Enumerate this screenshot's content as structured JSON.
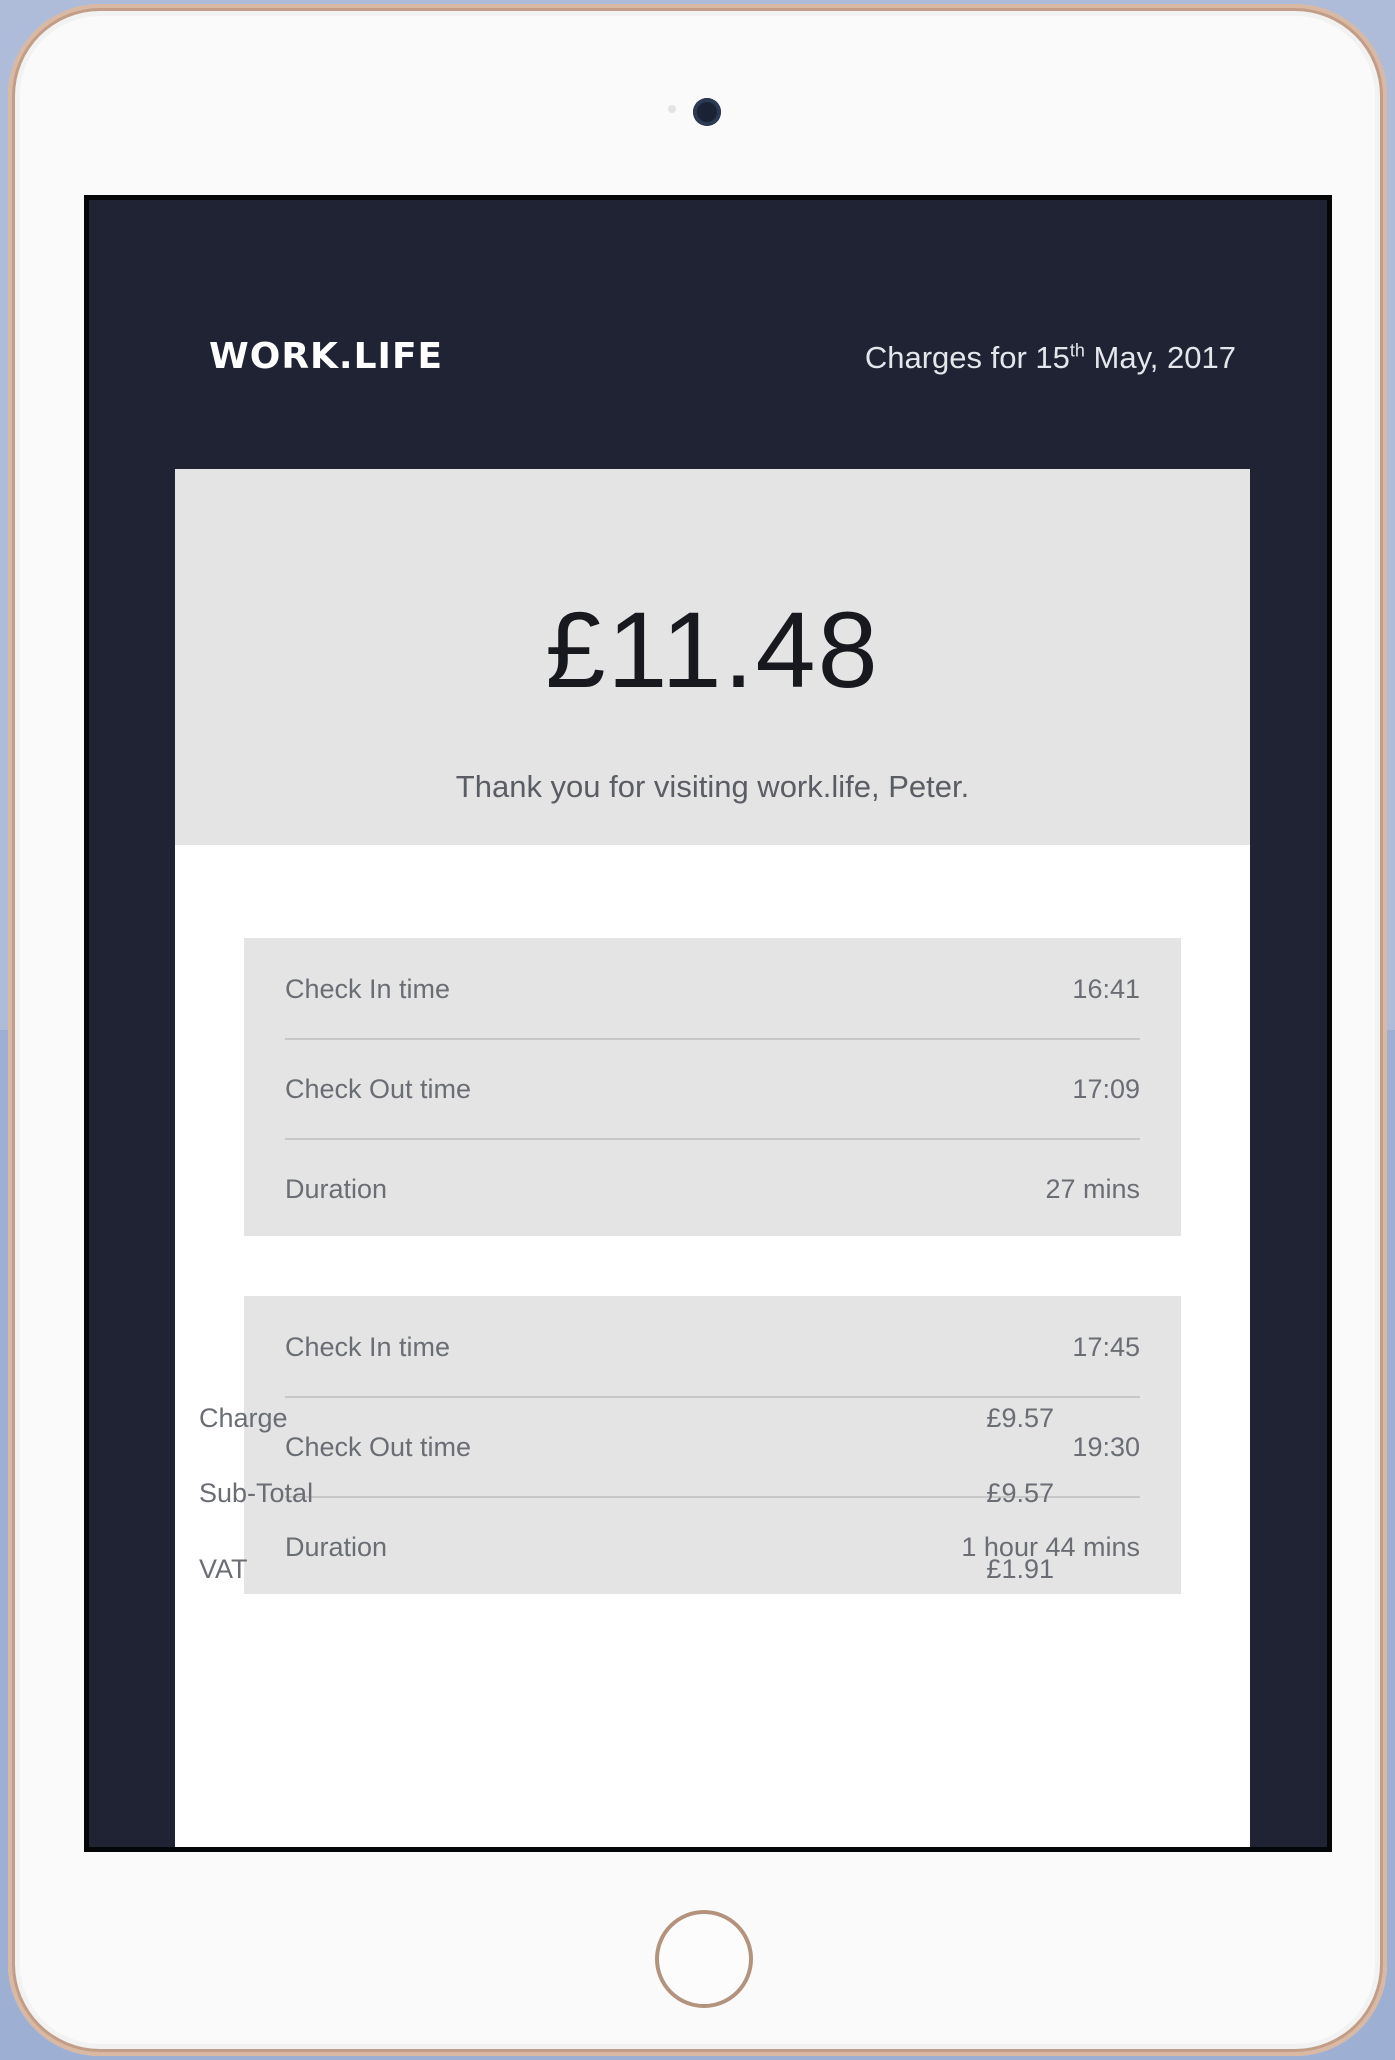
{
  "header": {
    "logo_text": "WORK.LIFE",
    "charges_prefix": "Charges for 15",
    "charges_suffix_sup": "th",
    "charges_rest": " May, 2017"
  },
  "summary": {
    "total_amount": "£11.48",
    "thank_you": "Thank you for visiting work.life, Peter."
  },
  "sessions": [
    {
      "check_in_label": "Check In time",
      "check_in_value": "16:41",
      "check_out_label": "Check Out time",
      "check_out_value": "17:09",
      "duration_label": "Duration",
      "duration_value": "27 mins"
    },
    {
      "check_in_label": "Check In time",
      "check_in_value": "17:45",
      "check_out_label": "Check Out time",
      "check_out_value": "19:30",
      "duration_label": "Duration",
      "duration_value": "1 hour 44 mins"
    }
  ],
  "totals": [
    {
      "label": "Charge",
      "value": "£9.57"
    },
    {
      "label": "Sub-Total",
      "value": "£9.57"
    },
    {
      "label": "VAT",
      "value": "£1.91"
    }
  ],
  "colors": {
    "header_bg": "#1f2333",
    "panel_bg": "#e4e4e4",
    "device_trim": "#c29e88"
  }
}
